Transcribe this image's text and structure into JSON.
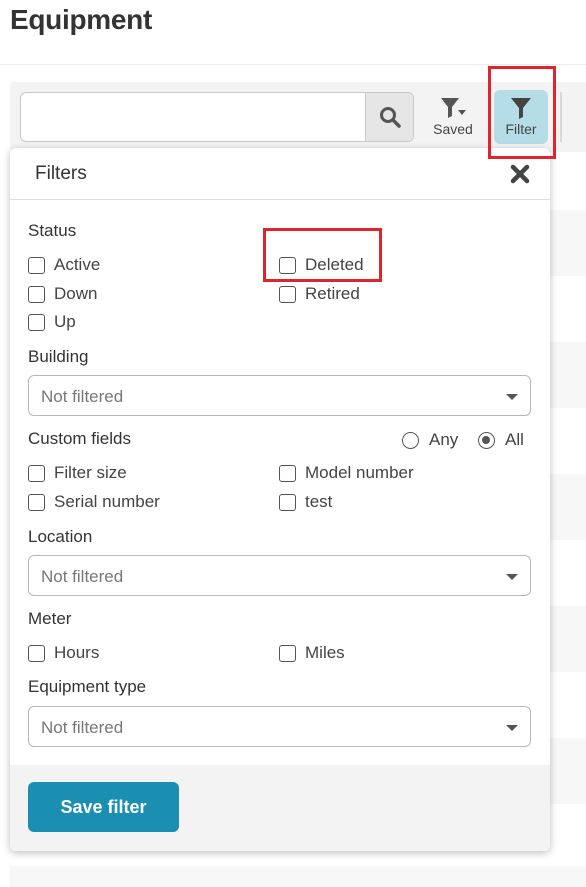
{
  "page": {
    "title": "Equipment"
  },
  "toolbar": {
    "search": {
      "value": "",
      "placeholder": ""
    },
    "saved_label": "Saved",
    "filter_label": "Filter"
  },
  "filters": {
    "title": "Filters",
    "status": {
      "label": "Status",
      "options": [
        "Active",
        "Deleted",
        "Down",
        "Retired",
        "Up"
      ]
    },
    "building": {
      "label": "Building",
      "selected": "Not filtered"
    },
    "custom_fields": {
      "label": "Custom fields",
      "match_options": [
        "Any",
        "All"
      ],
      "match_selected": "All",
      "options": [
        "Filter size",
        "Model number",
        "Serial number",
        "test"
      ]
    },
    "location": {
      "label": "Location",
      "selected": "Not filtered"
    },
    "meter": {
      "label": "Meter",
      "options": [
        "Hours",
        "Miles"
      ]
    },
    "equipment_type": {
      "label": "Equipment type",
      "selected": "Not filtered"
    },
    "save_label": "Save filter"
  },
  "colors": {
    "filter_active_bg": "#b5dde7",
    "primary_button": "#1a8fb2",
    "highlight_box": "#e0242b"
  }
}
